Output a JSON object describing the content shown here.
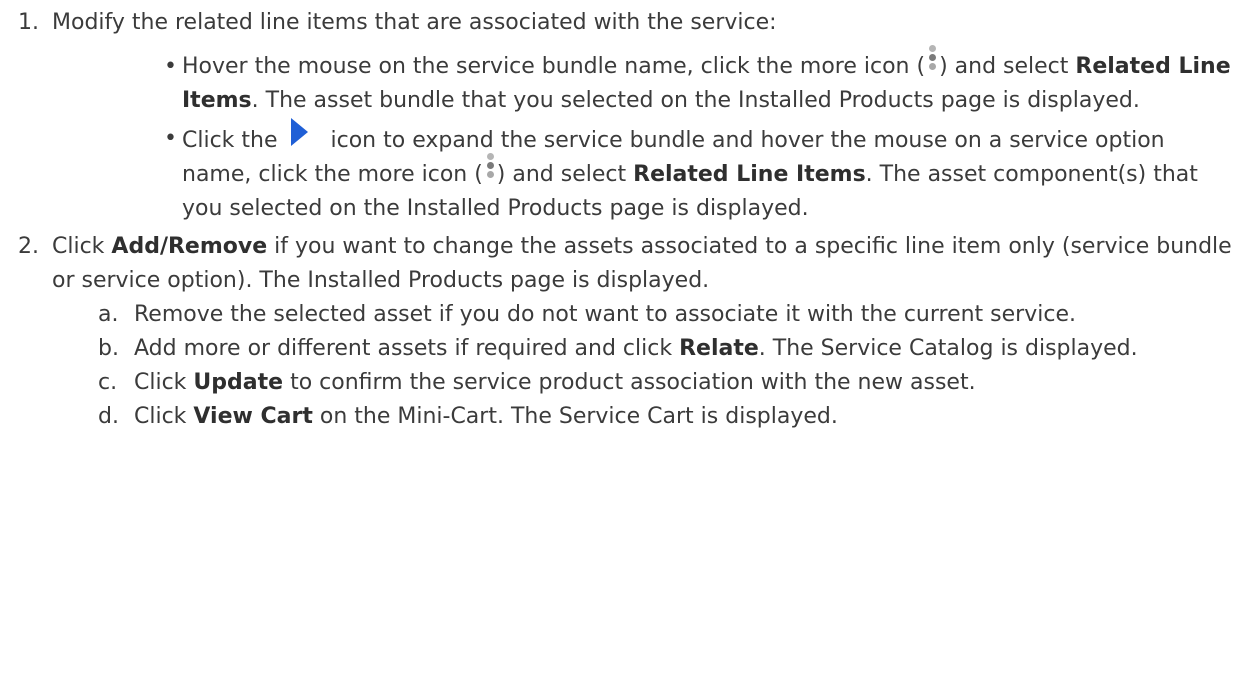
{
  "steps": [
    {
      "number": "1.",
      "text": "Modify the related line items that are associated with the service:",
      "bullets": [
        {
          "marker": "•",
          "t1": "Hover the mouse on the service bundle name, click the more icon (",
          "t2": ") and select ",
          "b1": "Related Line Items",
          "t3": ". The asset bundle that you selected on the Installed Products page is displayed."
        },
        {
          "marker": "•",
          "t1": "Click the ",
          "t2": " icon to expand the service bundle and hover the mouse on a service option name, click the more icon (",
          "t3": ") and select ",
          "b1": "Related Line Items",
          "t4": ". The asset component(s) that you selected on the Installed Products page is displayed."
        }
      ]
    },
    {
      "number": "2.",
      "t1": "Click ",
      "b1": "Add/Remove",
      "t2": " if you want to change the assets associated to a specific line item only (service bundle or service option). The Installed Products page is displayed.",
      "substeps": [
        {
          "letter": "a.",
          "t1": "Remove the selected asset if you do not want to associate it with the current service."
        },
        {
          "letter": "b.",
          "t1": "Add more or different assets if required and click ",
          "b1": "Relate",
          "t2": ". The Service Catalog is displayed."
        },
        {
          "letter": "c.",
          "t1": "Click ",
          "b1": "Update",
          "t2": " to confirm the service product association with the new asset."
        },
        {
          "letter": "d.",
          "t1": "Click ",
          "b1": "View Cart",
          "t2": " on the Mini-Cart. The Service Cart is displayed."
        }
      ]
    }
  ],
  "icons": {
    "more": "more-vertical-icon",
    "expand": "expand-triangle-icon",
    "expand_color": "#1f5fd6"
  }
}
